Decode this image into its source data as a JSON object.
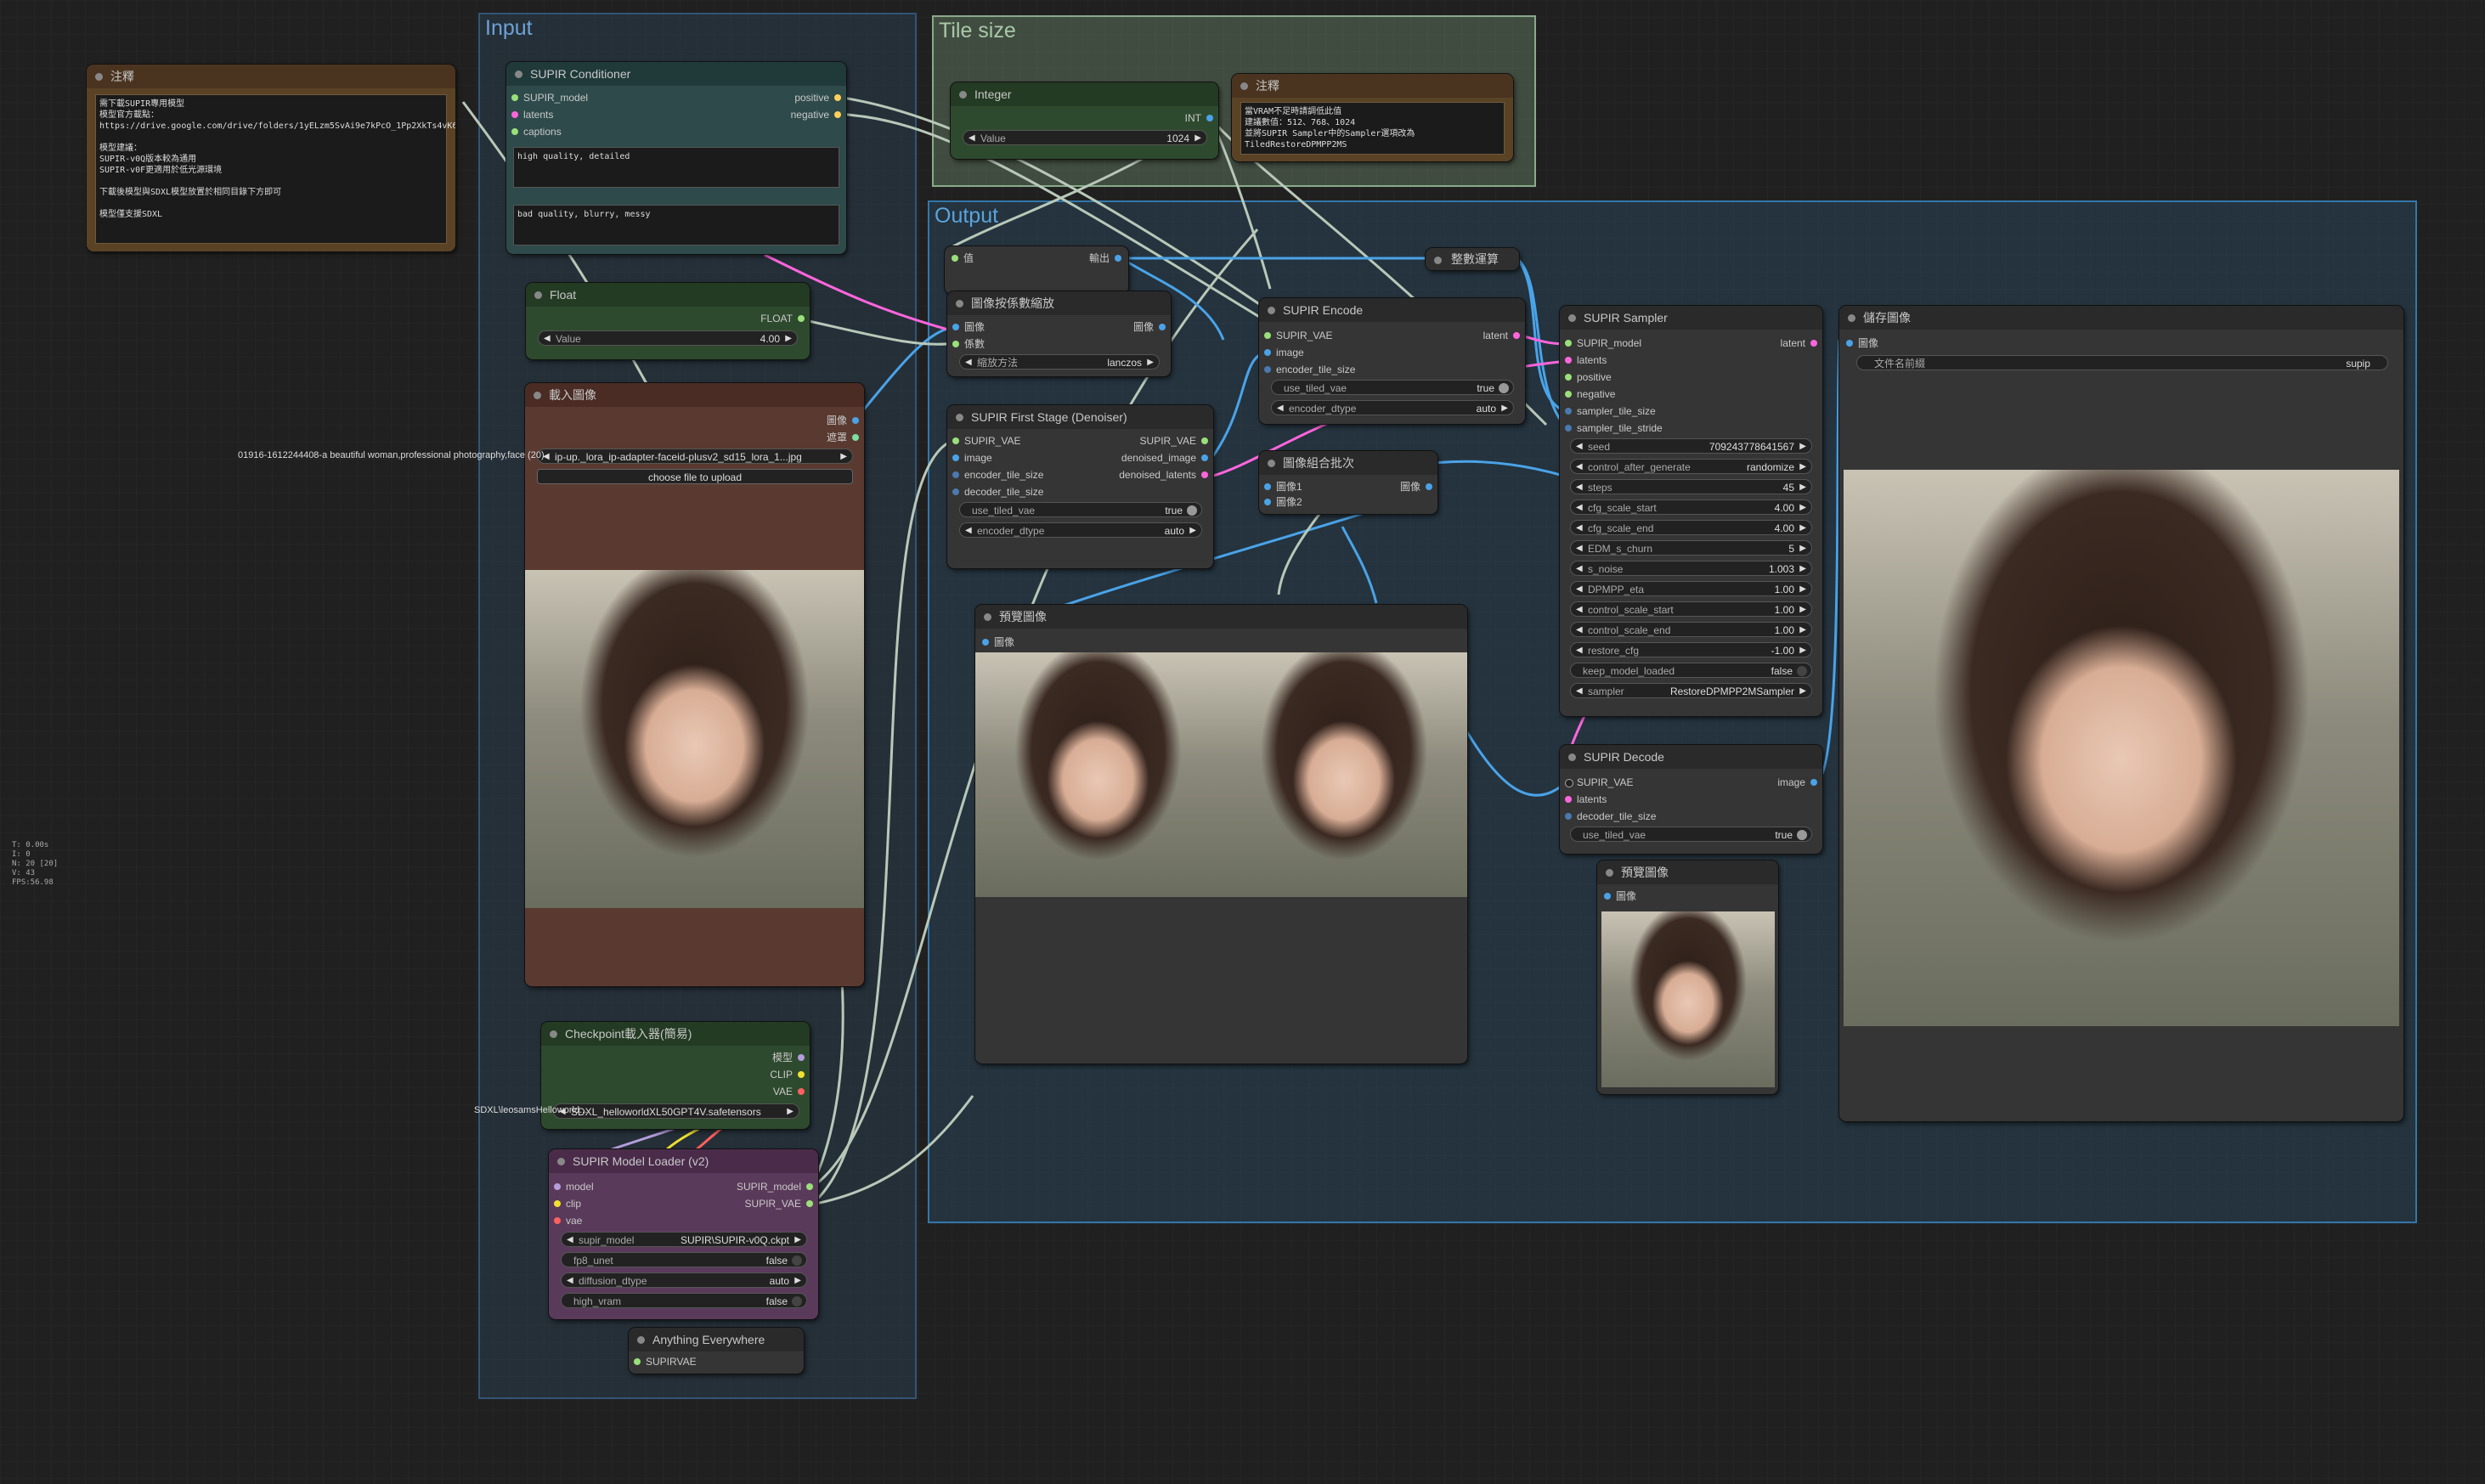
{
  "groups": {
    "input": "Input",
    "tile_size": "Tile size",
    "output": "Output"
  },
  "stats": [
    "T: 0.00s",
    "I: 0",
    "N: 20 [20]",
    "V: 43",
    "FPS:56.98"
  ],
  "note1": {
    "title": "注釋",
    "text": "需下載SUPIR專用模型\n模型官方載點：\nhttps://drive.google.com/drive/folders/1yELzm5SvAi9e7kPcO_1Pp2XkTs4vK6aR\n\n模型建議：\nSUPIR-v0Q版本較為通用\nSUPIR-v0F更適用於低光源環境\n\n下載後模型與SDXL模型放置於相同目錄下方即可\n\n模型僅支援SDXL"
  },
  "conditioner": {
    "title": "SUPIR Conditioner",
    "inputs": [
      "SUPIR_model",
      "latents",
      "captions"
    ],
    "outputs": [
      "positive",
      "negative"
    ],
    "positive_prompt": "high quality, detailed",
    "negative_prompt": "bad quality, blurry, messy"
  },
  "float": {
    "title": "Float",
    "output": "FLOAT",
    "label": "Value",
    "value": "4.00"
  },
  "load_image": {
    "title": "載入圖像",
    "outputs": [
      "圖像",
      "遮罩"
    ],
    "filename_label": "01916-1612244408-a beautiful woman,professional photography,face (20)",
    "filename_value": "ip-up._lora_ip-adapter-faceid-plusv2_sd15_lora_1...jpg",
    "upload": "choose file to upload"
  },
  "checkpoint": {
    "title": "Checkpoint載入器(簡易)",
    "outputs": [
      "模型",
      "CLIP",
      "VAE"
    ],
    "ckpt_label": "SDXL\\leosamsHelloworld...",
    "ckpt_value": "SDXL_helloworldXL50GPT4V.safetensors"
  },
  "model_loader": {
    "title": "SUPIR Model Loader (v2)",
    "inputs": [
      "model",
      "clip",
      "vae"
    ],
    "outputs": [
      "SUPIR_model",
      "SUPIR_VAE"
    ],
    "supir_model_label": "supir_model",
    "supir_model_value": "SUPIR\\SUPIR-v0Q.ckpt",
    "fp8_unet_label": "fp8_unet",
    "fp8_unet_value": "false",
    "diffusion_dtype_label": "diffusion_dtype",
    "diffusion_dtype_value": "auto",
    "high_vram_label": "high_vram",
    "high_vram_value": "false"
  },
  "anything_everywhere": {
    "title": "Anything Everywhere",
    "input": "SUPIRVAE"
  },
  "integer": {
    "title": "Integer",
    "output": "INT",
    "label": "Value",
    "value": "1024"
  },
  "note2": {
    "title": "注釋",
    "text": "當VRAM不足時請調低此值\n建議數值：512、768、1024\n並將SUPIR Sampler中的Sampler選項改為TiledRestoreDPMPP2MS"
  },
  "primitive": {
    "input": "值",
    "output": "輸出"
  },
  "round_int": {
    "title": "整數運算"
  },
  "resize": {
    "title": "圖像按係數縮放",
    "inputs": [
      "圖像",
      "係數"
    ],
    "output": "圖像",
    "method_label": "縮放方法",
    "method_value": "lanczos"
  },
  "first_stage": {
    "title": "SUPIR First Stage (Denoiser)",
    "inputs": [
      "SUPIR_VAE",
      "image",
      "encoder_tile_size",
      "decoder_tile_size"
    ],
    "outputs": [
      "SUPIR_VAE",
      "denoised_image",
      "denoised_latents"
    ],
    "use_tiled_vae_label": "use_tiled_vae",
    "use_tiled_vae_value": "true",
    "encoder_dtype_label": "encoder_dtype",
    "encoder_dtype_value": "auto"
  },
  "encode": {
    "title": "SUPIR Encode",
    "inputs": [
      "SUPIR_VAE",
      "image",
      "encoder_tile_size"
    ],
    "output": "latent",
    "use_tiled_vae_label": "use_tiled_vae",
    "use_tiled_vae_value": "true",
    "encoder_dtype_label": "encoder_dtype",
    "encoder_dtype_value": "auto"
  },
  "batch": {
    "title": "圖像組合批次",
    "inputs": [
      "圖像1",
      "圖像2"
    ],
    "output": "圖像"
  },
  "preview1": {
    "title": "預覽圖像",
    "input": "圖像"
  },
  "sampler": {
    "title": "SUPIR Sampler",
    "inputs": [
      "SUPIR_model",
      "latents",
      "positive",
      "negative",
      "sampler_tile_size",
      "sampler_tile_stride"
    ],
    "output": "latent",
    "widgets": [
      {
        "label": "seed",
        "value": "709243778641567"
      },
      {
        "label": "control_after_generate",
        "value": "randomize"
      },
      {
        "label": "steps",
        "value": "45"
      },
      {
        "label": "cfg_scale_start",
        "value": "4.00"
      },
      {
        "label": "cfg_scale_end",
        "value": "4.00"
      },
      {
        "label": "EDM_s_churn",
        "value": "5"
      },
      {
        "label": "s_noise",
        "value": "1.003"
      },
      {
        "label": "DPMPP_eta",
        "value": "1.00"
      },
      {
        "label": "control_scale_start",
        "value": "1.00"
      },
      {
        "label": "control_scale_end",
        "value": "1.00"
      },
      {
        "label": "restore_cfg",
        "value": "-1.00"
      }
    ],
    "keep_model_label": "keep_model_loaded",
    "keep_model_value": "false",
    "sampler_label": "sampler",
    "sampler_value": "RestoreDPMPP2MSampler"
  },
  "decode": {
    "title": "SUPIR Decode",
    "inputs": [
      "SUPIR_VAE",
      "latents",
      "decoder_tile_size"
    ],
    "output": "image",
    "use_tiled_vae_label": "use_tiled_vae",
    "use_tiled_vae_value": "true"
  },
  "preview2": {
    "title": "預覽圖像",
    "input": "圖像"
  },
  "save": {
    "title": "儲存圖像",
    "input": "圖像",
    "prefix_label": "文件名前綴",
    "prefix_value": "supip"
  },
  "colors": {
    "canvas": "#202020",
    "input_group": "#335577",
    "tile_group": "#88aa88",
    "output_group": "#3377aa",
    "wire_blue": "#4aa3e8",
    "wire_pink": "#ff66dd",
    "wire_gray": "#b8c8b8",
    "wire_yellow": "#f0e030"
  }
}
